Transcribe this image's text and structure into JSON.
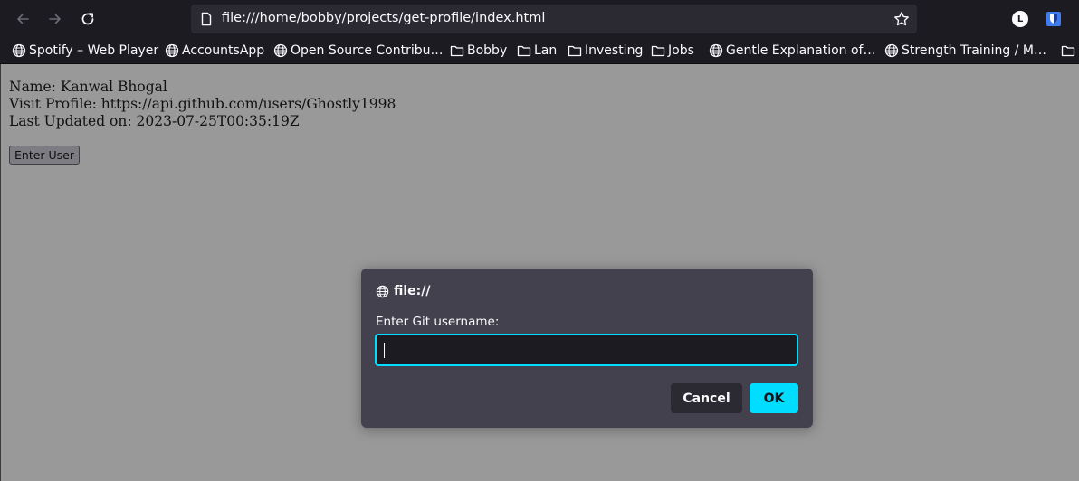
{
  "browser": {
    "url": "file:///home/bobby/projects/get-profile/index.html",
    "account_initial": "L",
    "bookmarks": [
      {
        "label": "Spotify – Web Player",
        "icon": "globe-icon"
      },
      {
        "label": "AccountsApp",
        "icon": "globe-icon"
      },
      {
        "label": "Open Source Contribu…",
        "icon": "globe-icon"
      },
      {
        "label": "Bobby",
        "icon": "folder-icon"
      },
      {
        "label": "Lan",
        "icon": "folder-icon"
      },
      {
        "label": "Investing",
        "icon": "folder-icon"
      },
      {
        "label": "Jobs",
        "icon": "folder-icon"
      },
      {
        "label": "Gentle Explanation of…",
        "icon": "globe-icon"
      },
      {
        "label": "Strength Training / M…",
        "icon": "globe-icon"
      },
      {
        "label": "",
        "icon": "folder-icon"
      }
    ]
  },
  "page": {
    "name_line": "Name: Kanwal Bhogal",
    "profile_line": "Visit Profile: https://api.github.com/users/Ghostly1998",
    "updated_line": "Last Updated on: 2023-07-25T00:35:19Z",
    "enter_user_label": "Enter User"
  },
  "dialog": {
    "origin": "file://",
    "message": "Enter Git username:",
    "input_value": "",
    "cancel_label": "Cancel",
    "ok_label": "OK"
  },
  "colors": {
    "chrome_bg": "#1c1b22",
    "urlbar_bg": "#2b2a33",
    "page_bg": "#999999",
    "dialog_bg": "#42414d",
    "accent": "#00ddff"
  }
}
